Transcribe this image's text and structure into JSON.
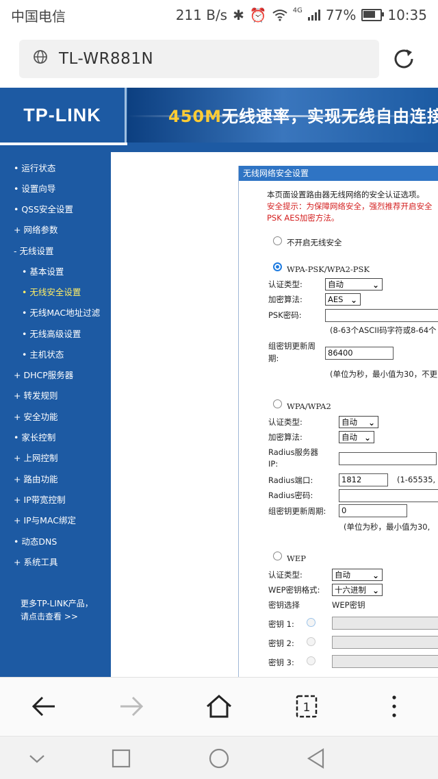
{
  "status_bar": {
    "carrier": "中国电信",
    "net_speed": "211 B/s",
    "signal": "4G",
    "battery": "77%",
    "battery_level": 0.77,
    "time": "10:35"
  },
  "browser": {
    "url": "TL-WR881N"
  },
  "router": {
    "logo": "TP-LINK",
    "slogan_highlight": "450M",
    "slogan_rest": "无线速率，实现无线自由连接梦想",
    "sidebar": [
      {
        "label": "• 运行状态"
      },
      {
        "label": "• 设置向导"
      },
      {
        "label": "• QSS安全设置"
      },
      {
        "label": "+ 网络参数"
      },
      {
        "label": "- 无线设置"
      },
      {
        "label": "• 基本设置"
      },
      {
        "label": "• 无线安全设置"
      },
      {
        "label": "• 无线MAC地址过滤"
      },
      {
        "label": "• 无线高级设置"
      },
      {
        "label": "• 主机状态"
      },
      {
        "label": "+ DHCP服务器"
      },
      {
        "label": "+ 转发规则"
      },
      {
        "label": "+ 安全功能"
      },
      {
        "label": "• 家长控制"
      },
      {
        "label": "+ 上网控制"
      },
      {
        "label": "+ 路由功能"
      },
      {
        "label": "+ IP带宽控制"
      },
      {
        "label": "+ IP与MAC绑定"
      },
      {
        "label": "• 动态DNS"
      },
      {
        "label": "+ 系统工具"
      }
    ],
    "more_line1": "更多TP-LINK产品，",
    "more_line2": "请点击查看 >>"
  },
  "panel": {
    "title": "无线网络安全设置",
    "intro": "本页面设置路由器无线网络的安全认证选项。",
    "warning_line1": "安全提示：为保障网络安全，强烈推荐开启安全",
    "warning_line2": "PSK AES加密方法。",
    "no_security_label": "不开启无线安全",
    "wpa_psk": {
      "label": "WPA-PSK/WPA2-PSK",
      "auth_label": "认证类型:",
      "auth_value": "自动",
      "enc_label": "加密算法:",
      "enc_value": "AES",
      "psk_label": "PSK密码:",
      "psk_value": "",
      "psk_hint": "(8-63个ASCII码字符或8-64个",
      "group_label_1": "组密钥更新周",
      "group_label_2": "期:",
      "group_value": "86400",
      "group_hint": "(单位为秒，最小值为30，不更"
    },
    "wpa": {
      "label": "WPA/WPA2",
      "auth_label": "认证类型:",
      "auth_value": "自动",
      "enc_label": "加密算法:",
      "enc_value": "自动",
      "radius_ip_label_1": "Radius服务器",
      "radius_ip_label_2": "IP:",
      "radius_ip_value": "",
      "radius_port_label": "Radius端口:",
      "radius_port_value": "1812",
      "radius_port_hint": "(1-65535,",
      "radius_pwd_label": "Radius密码:",
      "radius_pwd_value": "",
      "group_label": "组密钥更新周期:",
      "group_value": "0",
      "group_hint": "(单位为秒，最小值为30,"
    },
    "wep": {
      "label": "WEP",
      "auth_label": "认证类型:",
      "auth_value": "自动",
      "format_label": "WEP密钥格式:",
      "format_value": "十六进制",
      "key_select_label": "密钥选择",
      "key_col_label": "WEP密钥",
      "keys": [
        {
          "label": "密钥 1:"
        },
        {
          "label": "密钥 2:"
        },
        {
          "label": "密钥 3:"
        }
      ]
    }
  },
  "icons": {
    "alarm": "alarm-icon",
    "wifi": "wifi-icon",
    "bluetooth": "bluetooth-icon"
  }
}
